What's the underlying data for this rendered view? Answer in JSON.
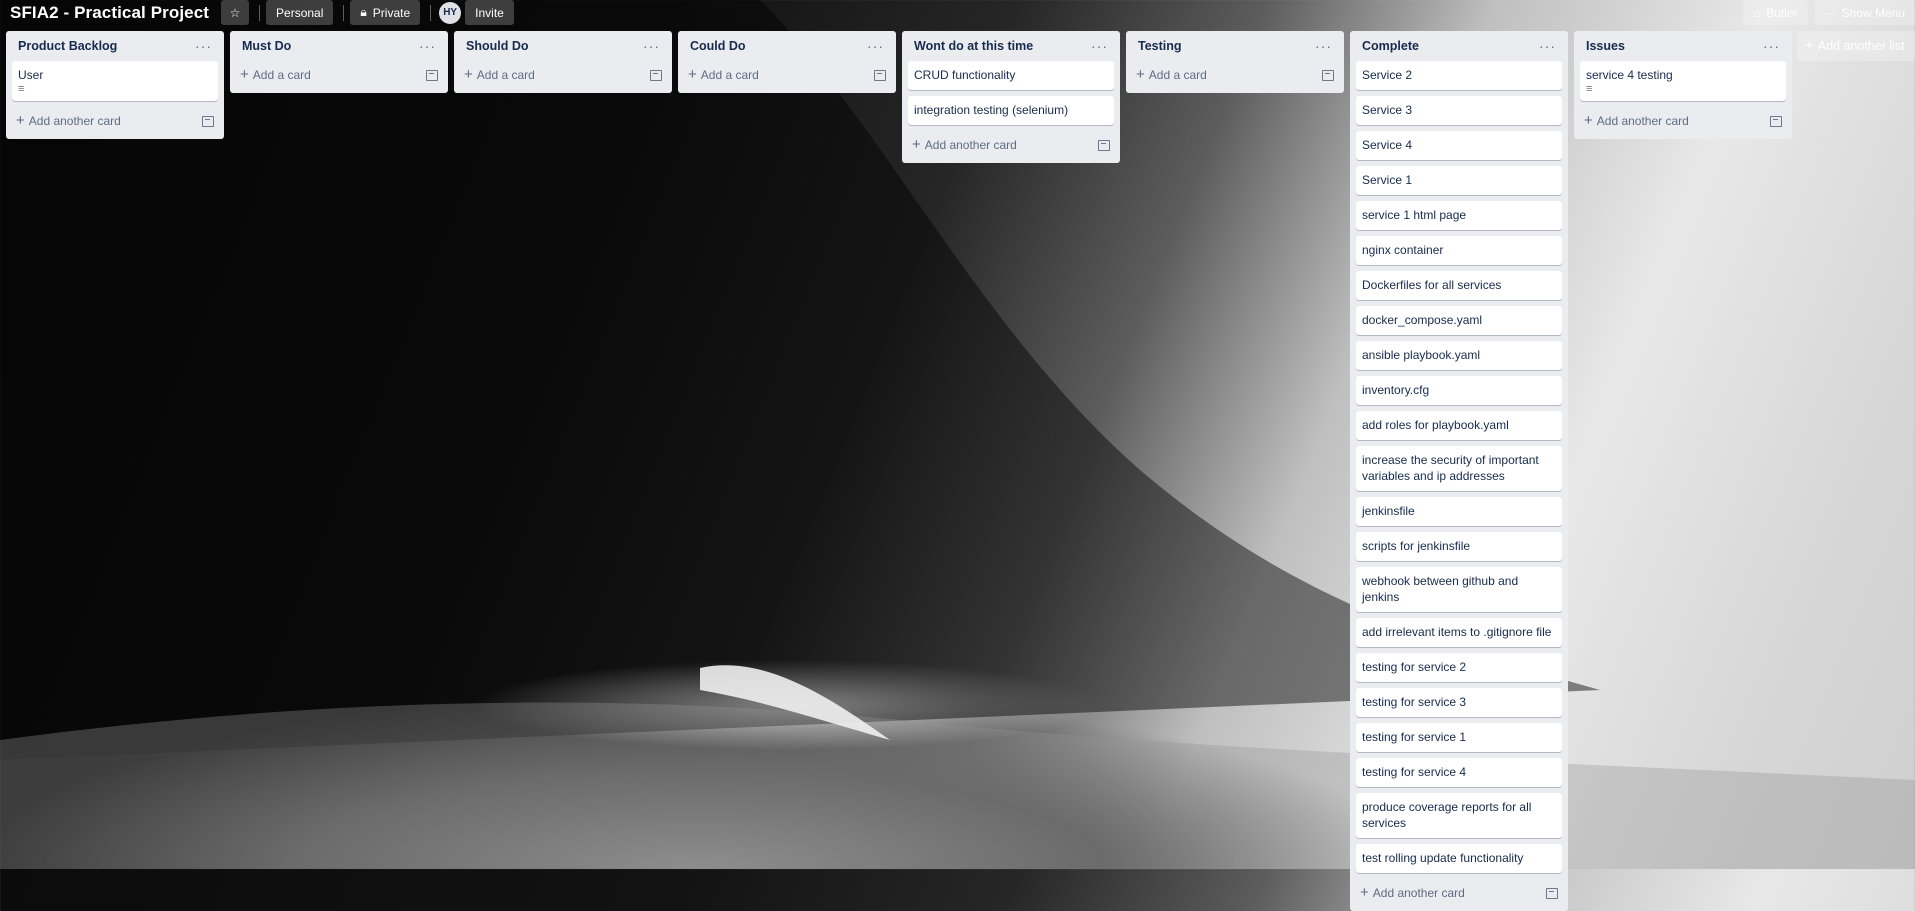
{
  "board": {
    "title": "SFIA2 - Practical Project",
    "team_label": "Personal",
    "visibility_label": "Private",
    "member_initials": "HY",
    "invite_label": "Invite",
    "butler_label": "Butler",
    "show_menu_label": "Show Menu",
    "add_list_label": "Add another list"
  },
  "icons": {
    "star": "star-icon",
    "lock": "lock-icon",
    "butler": "butler-icon",
    "more": "more-icon",
    "plus": "plus-icon",
    "template": "card-template-icon",
    "description": "description-icon"
  },
  "colors": {
    "list_bg": "#ebecf0",
    "card_bg": "#ffffff",
    "text": "#172b4d",
    "muted": "#5e6c84"
  },
  "lists": [
    {
      "title": "Product Backlog",
      "cards": [
        {
          "text": "User",
          "has_desc": true
        }
      ],
      "footer": "Add another card"
    },
    {
      "title": "Must Do",
      "cards": [],
      "footer": "Add a card"
    },
    {
      "title": "Should Do",
      "cards": [],
      "footer": "Add a card"
    },
    {
      "title": "Could Do",
      "cards": [],
      "footer": "Add a card"
    },
    {
      "title": "Wont do at this time",
      "cards": [
        {
          "text": "CRUD functionality"
        },
        {
          "text": "integration testing (selenium)"
        }
      ],
      "footer": "Add another card"
    },
    {
      "title": "Testing",
      "cards": [],
      "footer": "Add a card"
    },
    {
      "title": "Complete",
      "cards": [
        {
          "text": "Service 2"
        },
        {
          "text": "Service 3"
        },
        {
          "text": "Service 4"
        },
        {
          "text": "Service 1"
        },
        {
          "text": "service 1 html page"
        },
        {
          "text": "nginx container"
        },
        {
          "text": "Dockerfiles for all services"
        },
        {
          "text": "docker_compose.yaml"
        },
        {
          "text": "ansible playbook.yaml"
        },
        {
          "text": "inventory.cfg"
        },
        {
          "text": "add roles for playbook.yaml"
        },
        {
          "text": "increase the security of important variables and ip addresses"
        },
        {
          "text": "jenkinsfile"
        },
        {
          "text": "scripts for jenkinsfile"
        },
        {
          "text": "webhook between github and jenkins"
        },
        {
          "text": "add irrelevant items to .gitignore file"
        },
        {
          "text": "testing for service 2"
        },
        {
          "text": "testing for service 3"
        },
        {
          "text": "testing for service 1"
        },
        {
          "text": "testing for service 4"
        },
        {
          "text": "produce coverage reports for all services"
        },
        {
          "text": "test rolling update functionality"
        }
      ],
      "footer": "Add another card"
    },
    {
      "title": "Issues",
      "cards": [
        {
          "text": "service 4 testing",
          "has_desc": true
        }
      ],
      "footer": "Add another card"
    }
  ]
}
